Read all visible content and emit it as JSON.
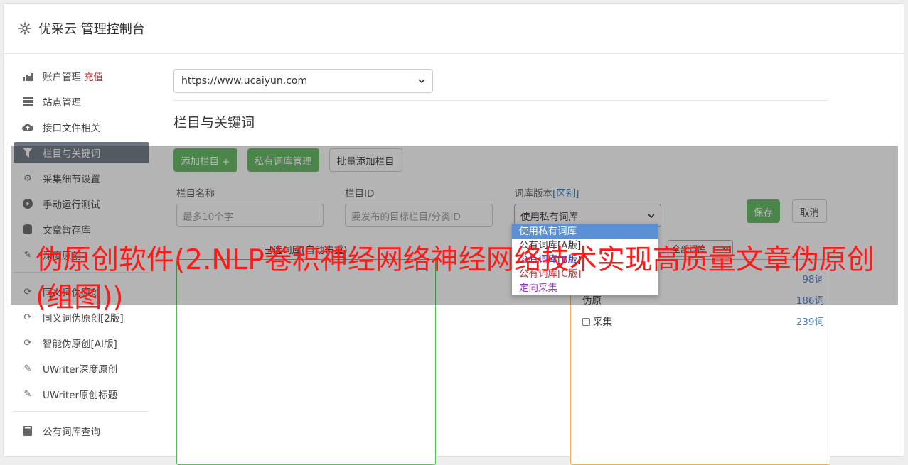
{
  "header": {
    "title": "优采云 管理控制台",
    "icon": "gear-icon"
  },
  "sidebar": {
    "items": [
      {
        "label": "账户管理",
        "badge": "充值",
        "icon": "bar-chart-icon"
      },
      {
        "label": "站点管理",
        "icon": "server-icon"
      },
      {
        "label": "接口文件相关",
        "icon": "cloud-upload-icon"
      },
      {
        "label": "栏目与关键词",
        "icon": "filter-icon",
        "active": true
      },
      {
        "label": "采集细节设置",
        "icon": "cogs-icon"
      },
      {
        "label": "手动运行测试",
        "icon": "play-circle-icon"
      },
      {
        "label": "文章暂存库",
        "icon": "database-icon"
      },
      {
        "label": "深度原创",
        "icon": "edit-icon"
      },
      {
        "label": "同义词伪原创",
        "icon": "refresh-icon"
      },
      {
        "label": "同义词伪原创[2版]",
        "icon": "refresh-icon"
      },
      {
        "label": "智能伪原创[AI版]",
        "icon": "refresh-icon"
      },
      {
        "label": "UWriter深度原创",
        "icon": "edit-icon"
      },
      {
        "label": "UWriter原创标题",
        "icon": "edit-icon"
      }
    ],
    "bottom_item": {
      "label": "公有词库查询",
      "icon": "book-icon"
    }
  },
  "main": {
    "site_select_value": "https://www.ucaiyun.com",
    "section_title": "栏目与关键词",
    "buttons": {
      "add_column": "添加栏目 +",
      "private_lib": "私有词库管理",
      "batch_add": "批量添加栏目"
    },
    "form": {
      "column_name_label": "栏目名称",
      "column_name_placeholder": "最多10个字",
      "column_id_label": "栏目ID",
      "column_id_placeholder": "要发布的目标栏目/分类ID",
      "lib_version_label": "词库版本",
      "lib_version_link": "[区别]",
      "lib_version_value": "使用私有词库",
      "save": "保存",
      "cancel": "取消"
    },
    "dropdown_options": [
      "使用私有词库",
      "公有词库[A版]",
      "公有词库[B版]",
      "公有词库[C版]",
      "定向采集"
    ],
    "selected_panel_title": "已选词库(自动去重)",
    "all_libs_select": "全部词库",
    "libs": [
      {
        "name": "",
        "count": "98词"
      },
      {
        "name": "伪原",
        "count": "186词"
      },
      {
        "name": "采集",
        "count": "239词"
      }
    ]
  },
  "watermark": "伪原创软件(2.NLP卷积神经网络神经网络技术实现高质量文章伪原创(组图))",
  "colors": {
    "green": "#5cb85c",
    "active_nav": "#6c7581",
    "watermark": "#ff1a1a",
    "selected_option": "#5b8fd6"
  }
}
